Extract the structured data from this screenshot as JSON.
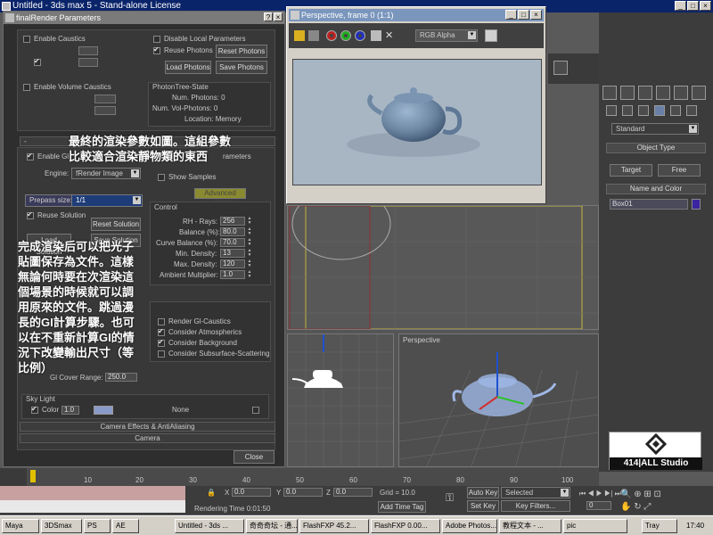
{
  "app": {
    "window_title": "Untitled - 3ds max 5 - Stand-alone License"
  },
  "final_render": {
    "title": "finalRender Parameters",
    "caustics": {
      "enable_caustics": "Enable Caustics",
      "disable_local": "Disable Local Parameters",
      "reuse_photons": "Reuse Photons",
      "reset_photons": "Reset Photons",
      "load_photons": "Load Photons",
      "save_photons": "Save Photons",
      "enable_volume": "Enable Volume Caustics",
      "state_title": "PhotonTree-State",
      "num_photons": "Num. Photons: 0",
      "num_vol_photons": "Num. Vol-Photons: 0",
      "location": "Location: Memory"
    },
    "gi": {
      "enable_gi": "Enable Gl",
      "parameters_frag": "rameters",
      "engine_label": "Engine:",
      "engine_value": "fRender Image",
      "show_samples": "Show Samples",
      "advanced_controls": "Advanced Controls",
      "prepass_label": "Prepass size:",
      "prepass_value": "1/1",
      "reuse_solution": "Reuse Solution",
      "reset_solution": "Reset Solution",
      "load_solution": "Load Solution",
      "save_solution": "Save Solution",
      "control_title": "Control",
      "controls": [
        {
          "label": "RH - Rays:",
          "value": "256"
        },
        {
          "label": "Balance (%):",
          "value": "80.0"
        },
        {
          "label": "Curve Balance (%):",
          "value": "70.0"
        },
        {
          "label": "Min. Density:",
          "value": "13"
        },
        {
          "label": "Max. Density:",
          "value": "120"
        },
        {
          "label": "Ambient Multiplier:",
          "value": "1.0"
        }
      ],
      "render_gi_caustics": "Render Gl-Caustics",
      "consider_atmospherics": "Consider Atmospherics",
      "consider_background": "Consider Background",
      "consider_sss": "Consider Subsurface-Scattering",
      "gi_cover_range_label": "Gl Cover Range:",
      "gi_cover_range_value": "250.0",
      "sky_light": "Sky Light",
      "color_label": "Color",
      "color_value": "1.0",
      "none_label": "None"
    },
    "sections": [
      "Camera Effects & AntiAliasing",
      "Camera"
    ],
    "close_label": "Close"
  },
  "overlay_top": [
    "最終的渲染參數如圖。這組參數",
    "比較適合渲染靜物類的東西"
  ],
  "overlay_left": [
    "完成渲染后可以把光子",
    "貼圖保存為文件。這樣",
    "無論何時要在次渲染這",
    "個場景的時候就可以調",
    "用原來的文件。跳過漫",
    "長的GI計算步驟。也可",
    "以在不重新計算GI的情",
    "況下改變輸出尺寸（等",
    "比例）"
  ],
  "render_window": {
    "title": "Perspective, frame 0 (1:1)",
    "channel": "RGB Alpha"
  },
  "command_panel": {
    "dropdown": "Standard",
    "object_type": "Object Type",
    "target": "Target",
    "free": "Free",
    "name_color": "Name and Color",
    "object_name": "Box01"
  },
  "viewports": {
    "perspective_label": "Perspective"
  },
  "timeline": {
    "ticks": [
      "10",
      "20",
      "30",
      "40",
      "50",
      "60",
      "70",
      "80",
      "90",
      "100"
    ]
  },
  "status": {
    "x_label": "X",
    "x_value": "0.0",
    "y_label": "Y",
    "y_value": "0.0",
    "z_label": "Z",
    "z_value": "0.0",
    "grid": "Grid = 10.0",
    "auto_key": "Auto Key",
    "selected": "Selected",
    "set_key": "Set Key",
    "key_filters": "Key Filters...",
    "rendering_time": "Rendering Time  0:01:50",
    "add_time_tag": "Add Time Tag",
    "frame_value": "0"
  },
  "taskbar": {
    "items": [
      "Maya",
      "3DSmax",
      "PS",
      "AE",
      "Untitled - 3ds ...",
      "奇奇奇坛 - 通...",
      "FlashFXP 45.2...",
      "FlashFXP 0.00...",
      "Adobe Photos...",
      "教程文本 - ...",
      "pic"
    ],
    "tray": "Tray",
    "clock": "17:40"
  },
  "watermark": "414|ALL Studio"
}
